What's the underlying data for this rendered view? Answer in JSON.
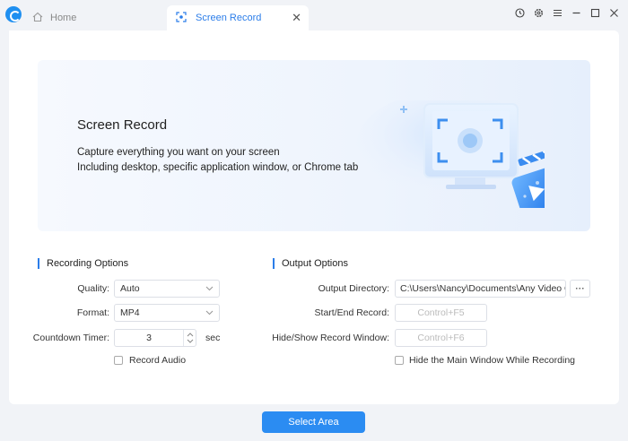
{
  "tabs": {
    "home": "Home",
    "active": "Screen Record"
  },
  "banner": {
    "title": "Screen Record",
    "line1": "Capture everything you want on your screen",
    "line2": "Including desktop, specific application window, or Chrome tab"
  },
  "recording": {
    "title": "Recording Options",
    "quality_label": "Quality:",
    "quality_value": "Auto",
    "format_label": "Format:",
    "format_value": "MP4",
    "countdown_label": "Countdown Timer:",
    "countdown_value": "3",
    "countdown_unit": "sec",
    "record_audio_label": "Record Audio"
  },
  "output": {
    "title": "Output Options",
    "dir_label": "Output Directory:",
    "dir_value": "C:\\Users\\Nancy\\Documents\\Any Video C",
    "start_label": "Start/End Record:",
    "start_value": "Control+F5",
    "hide_label": "Hide/Show Record Window:",
    "hide_value": "Control+F6",
    "hide_main_label": "Hide the Main Window While Recording",
    "more": "···"
  },
  "action": {
    "select_area": "Select Area"
  },
  "colors": {
    "accent": "#2b7de9",
    "button": "#2b8cf2"
  },
  "icons": [
    "app-logo",
    "home-icon",
    "screen-record-icon",
    "close-icon",
    "history-icon",
    "settings-icon",
    "menu-icon",
    "minimize-icon",
    "maximize-icon",
    "window-close-icon"
  ]
}
